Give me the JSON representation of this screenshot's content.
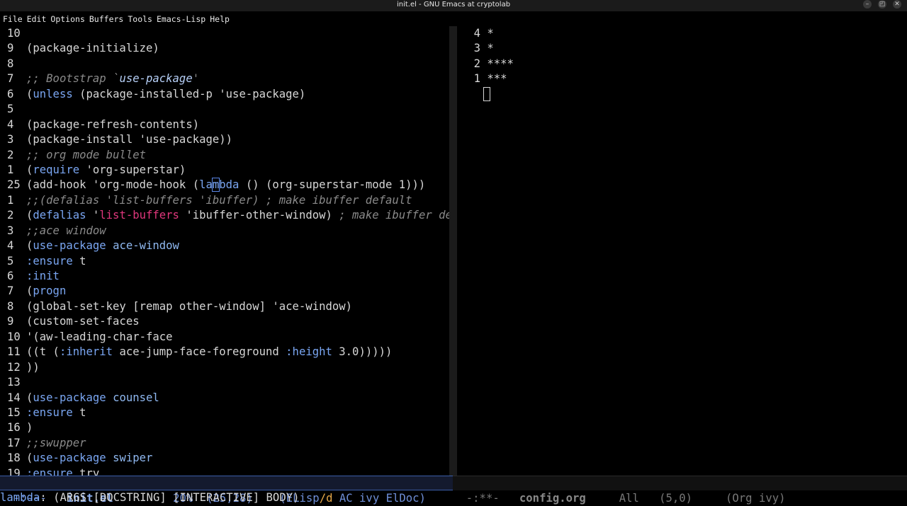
{
  "window": {
    "title": "init.el - GNU Emacs at cryptolab",
    "buttons": [
      "–",
      "◰",
      "✕"
    ]
  },
  "menubar": [
    "File",
    "Edit",
    "Options",
    "Buffers",
    "Tools",
    "Emacs-Lisp",
    "Help"
  ],
  "left_buffer": {
    "lines": [
      {
        "num": "10",
        "segments": []
      },
      {
        "num": "9",
        "segments": [
          {
            "t": "(package-initialize)",
            "c": "plain"
          }
        ]
      },
      {
        "num": "8",
        "segments": []
      },
      {
        "num": "7",
        "segments": [
          {
            "t": ";; Bootstrap `",
            "c": "comment"
          },
          {
            "t": "use-package",
            "c": "quoted"
          },
          {
            "t": "'",
            "c": "comment"
          }
        ]
      },
      {
        "num": "6",
        "segments": [
          {
            "t": "(",
            "c": "plain"
          },
          {
            "t": "unless",
            "c": "kw"
          },
          {
            "t": " (package-installed-p 'use-package)",
            "c": "plain"
          }
        ]
      },
      {
        "num": "5",
        "segments": []
      },
      {
        "num": "4",
        "segments": [
          {
            "t": "(package-refresh-contents)",
            "c": "plain"
          }
        ]
      },
      {
        "num": "3",
        "segments": [
          {
            "t": "(package-install 'use-package))",
            "c": "plain"
          }
        ]
      },
      {
        "num": "2",
        "segments": [
          {
            "t": ";; org mode bullet",
            "c": "comment"
          }
        ]
      },
      {
        "num": "1",
        "segments": [
          {
            "t": "(",
            "c": "plain"
          },
          {
            "t": "require",
            "c": "kw"
          },
          {
            "t": " 'org-superstar)",
            "c": "plain"
          }
        ]
      },
      {
        "num": "25",
        "segments": [
          {
            "t": "(add-hook 'org-mode-hook (",
            "c": "plain"
          },
          {
            "t": "la",
            "c": "kw"
          },
          {
            "t": "m",
            "c": "cursor"
          },
          {
            "t": "bda",
            "c": "kw"
          },
          {
            "t": " () (org-superstar-mode 1)))",
            "c": "plain"
          }
        ]
      },
      {
        "num": "1",
        "segments": [
          {
            "t": ";;(defalias 'list-buffers 'ibuffer) ; make ibuffer default",
            "c": "comment"
          }
        ]
      },
      {
        "num": "2",
        "segments": [
          {
            "t": "(",
            "c": "plain"
          },
          {
            "t": "defalias",
            "c": "kw"
          },
          {
            "t": " '",
            "c": "plain"
          },
          {
            "t": "list-buffers",
            "c": "fname"
          },
          {
            "t": " 'ibuffer-other-window) ",
            "c": "plain"
          },
          {
            "t": "; make ibuffer default",
            "c": "comment"
          }
        ]
      },
      {
        "num": "3",
        "segments": [
          {
            "t": ";;ace window",
            "c": "comment"
          }
        ]
      },
      {
        "num": "4",
        "segments": [
          {
            "t": "(",
            "c": "plain"
          },
          {
            "t": "use-package",
            "c": "kw"
          },
          {
            "t": " ",
            "c": "plain"
          },
          {
            "t": "ace-window",
            "c": "var"
          }
        ]
      },
      {
        "num": "5",
        "segments": [
          {
            "t": ":ensure",
            "c": "const"
          },
          {
            "t": " t",
            "c": "plain"
          }
        ]
      },
      {
        "num": "6",
        "segments": [
          {
            "t": ":init",
            "c": "const"
          }
        ]
      },
      {
        "num": "7",
        "segments": [
          {
            "t": "(",
            "c": "plain"
          },
          {
            "t": "progn",
            "c": "kw"
          }
        ]
      },
      {
        "num": "8",
        "segments": [
          {
            "t": "(global-set-key [remap other-window] 'ace-window)",
            "c": "plain"
          }
        ]
      },
      {
        "num": "9",
        "segments": [
          {
            "t": "(custom-set-faces",
            "c": "plain"
          }
        ]
      },
      {
        "num": "10",
        "segments": [
          {
            "t": "'(aw-leading-char-face",
            "c": "plain"
          }
        ]
      },
      {
        "num": "11",
        "segments": [
          {
            "t": "((t (",
            "c": "plain"
          },
          {
            "t": ":inherit",
            "c": "const"
          },
          {
            "t": " ace-jump-face-foreground ",
            "c": "plain"
          },
          {
            "t": ":height",
            "c": "const"
          },
          {
            "t": " 3.0)))))",
            "c": "plain"
          }
        ]
      },
      {
        "num": "12",
        "segments": [
          {
            "t": "))",
            "c": "plain"
          }
        ]
      },
      {
        "num": "13",
        "segments": []
      },
      {
        "num": "14",
        "segments": [
          {
            "t": "(",
            "c": "plain"
          },
          {
            "t": "use-package",
            "c": "kw"
          },
          {
            "t": " ",
            "c": "plain"
          },
          {
            "t": "counsel",
            "c": "var"
          }
        ]
      },
      {
        "num": "15",
        "segments": [
          {
            "t": ":ensure",
            "c": "const"
          },
          {
            "t": " t",
            "c": "plain"
          }
        ]
      },
      {
        "num": "16",
        "segments": [
          {
            "t": ")",
            "c": "plain"
          }
        ]
      },
      {
        "num": "17",
        "segments": [
          {
            "t": ";;swupper",
            "c": "comment"
          }
        ]
      },
      {
        "num": "18",
        "segments": [
          {
            "t": "(",
            "c": "plain"
          },
          {
            "t": "use-package",
            "c": "kw"
          },
          {
            "t": " ",
            "c": "plain"
          },
          {
            "t": "swiper",
            "c": "var"
          }
        ]
      },
      {
        "num": "19",
        "segments": [
          {
            "t": ":ensure",
            "c": "const"
          },
          {
            "t": " try",
            "c": "plain"
          }
        ]
      }
    ]
  },
  "right_buffer": {
    "lines": [
      {
        "num": "4",
        "text": "*"
      },
      {
        "num": "3",
        "text": "*"
      },
      {
        "num": "2",
        "text": "****"
      },
      {
        "num": "1",
        "text": "***"
      }
    ]
  },
  "left_modeline": {
    "status": "-:---",
    "buffer": "init.el",
    "percent": "20%",
    "position": "(25,28)",
    "mode_open": "(ELisp",
    "mode_sub": "/d",
    "mode_rest": " AC ivy ElDoc)"
  },
  "right_modeline": {
    "status": "-:**-",
    "buffer": "config.org",
    "percent": "All",
    "position": "(5,0)",
    "modes": "(Org ivy)"
  },
  "echo": {
    "function": "lambda",
    "signature": ": (ARGS [DOCSTRING] [INTERACTIVE] BODY)"
  },
  "colors": {
    "keyword": "#7aa6f2",
    "comment": "#8a8a8a",
    "function_name": "#e0377c",
    "modeline_accent": "#e8a94a"
  }
}
